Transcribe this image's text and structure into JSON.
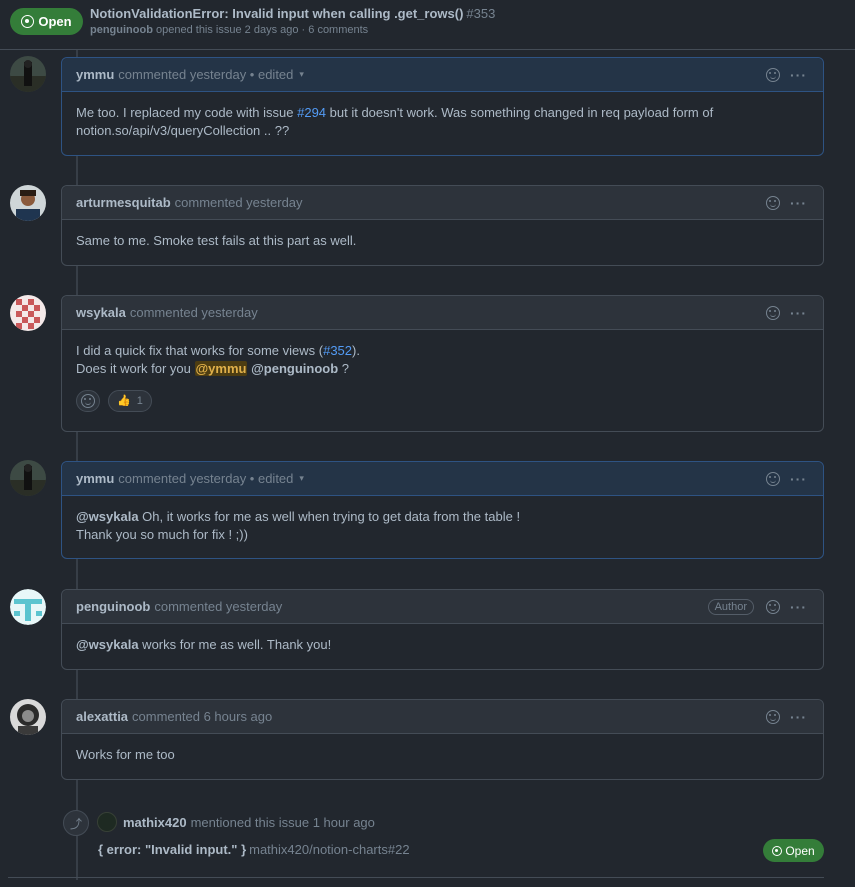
{
  "header": {
    "state": "Open",
    "title": "NotionValidationError: Invalid input when calling .get_rows()",
    "number": "#353",
    "opener": "penguinoob",
    "meta_rest": "opened this issue 2 days ago · 6 comments"
  },
  "comments": [
    {
      "author": "ymmu",
      "meta": "commented yesterday • edited",
      "caret": "▾",
      "p1": "Me too. I replaced my code with issue ",
      "link": "#294",
      "p2": " but it doesn't work. Was something changed in req payload form of notion.so/api/v3/queryCollection .. ??"
    },
    {
      "author": "arturmesquitab",
      "meta": "commented yesterday",
      "text": "Same to me. Smoke test fails at this part as well."
    },
    {
      "author": "wsykala",
      "meta": "commented yesterday",
      "l1a": "I did a quick fix that works for some views (",
      "l1link": "#352",
      "l1b": ").",
      "l2a": "Does it work for you ",
      "mention1": "@ymmu",
      "mention2": "@penguinoob",
      "l2b": " ?",
      "reaction_emoji": "👍",
      "reaction_count": "1"
    },
    {
      "author": "ymmu",
      "meta": "commented yesterday • edited",
      "caret": "▾",
      "mention": "@wsykala",
      "l1": " Oh, it works for me as well when trying to get data from the table !",
      "l2": "Thank you so much for fix ! ;))"
    },
    {
      "author": "penguinoob",
      "meta": "commented yesterday",
      "badge": "Author",
      "mention": "@wsykala",
      "text": " works for me as well. Thank you!"
    },
    {
      "author": "alexattia",
      "meta": "commented 6 hours ago",
      "text": "Works for me too"
    }
  ],
  "event": {
    "author": "mathix420",
    "text": "mentioned this issue 1 hour ago",
    "ref_title": "{ error: \"Invalid input.\" }",
    "ref_link": "mathix420/notion-charts#22",
    "state": "Open"
  },
  "icons": {
    "kebab": "···",
    "xref": "⤴"
  }
}
